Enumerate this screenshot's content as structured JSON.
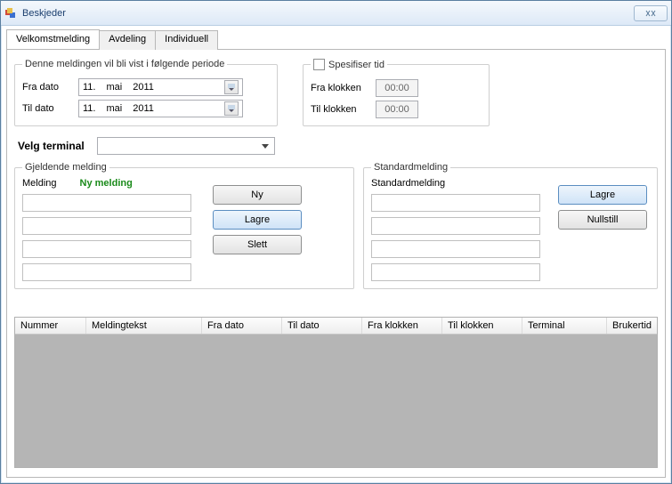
{
  "window": {
    "title": "Beskjeder"
  },
  "tabs": {
    "t0": "Velkomstmelding",
    "t1": "Avdeling",
    "t2": "Individuell"
  },
  "period": {
    "legend": "Denne meldingen vil bli vist i følgende periode",
    "from_label": "Fra dato",
    "to_label": "Til dato",
    "from_day": "11.",
    "from_month": "mai",
    "from_year": "2011",
    "to_day": "11.",
    "to_month": "mai",
    "to_year": "2011"
  },
  "time": {
    "legend": "Spesifiser tid",
    "from_label": "Fra klokken",
    "to_label": "Til klokken",
    "from_value": "00:00",
    "to_value": "00:00"
  },
  "terminal": {
    "label": "Velg terminal",
    "value": ""
  },
  "current": {
    "legend": "Gjeldende melding",
    "melding_label": "Melding",
    "ny_label": "Ny melding",
    "btn_new": "Ny",
    "btn_save": "Lagre",
    "btn_delete": "Slett"
  },
  "standard": {
    "legend": "Standardmelding",
    "label": "Standardmelding",
    "btn_save": "Lagre",
    "btn_reset": "Nullstill"
  },
  "table": {
    "cols": {
      "c0": "Nummer",
      "c1": "Meldingtekst",
      "c2": "Fra dato",
      "c3": "Til dato",
      "c4": "Fra klokken",
      "c5": "Til klokken",
      "c6": "Terminal",
      "c7": "Brukertid"
    }
  }
}
